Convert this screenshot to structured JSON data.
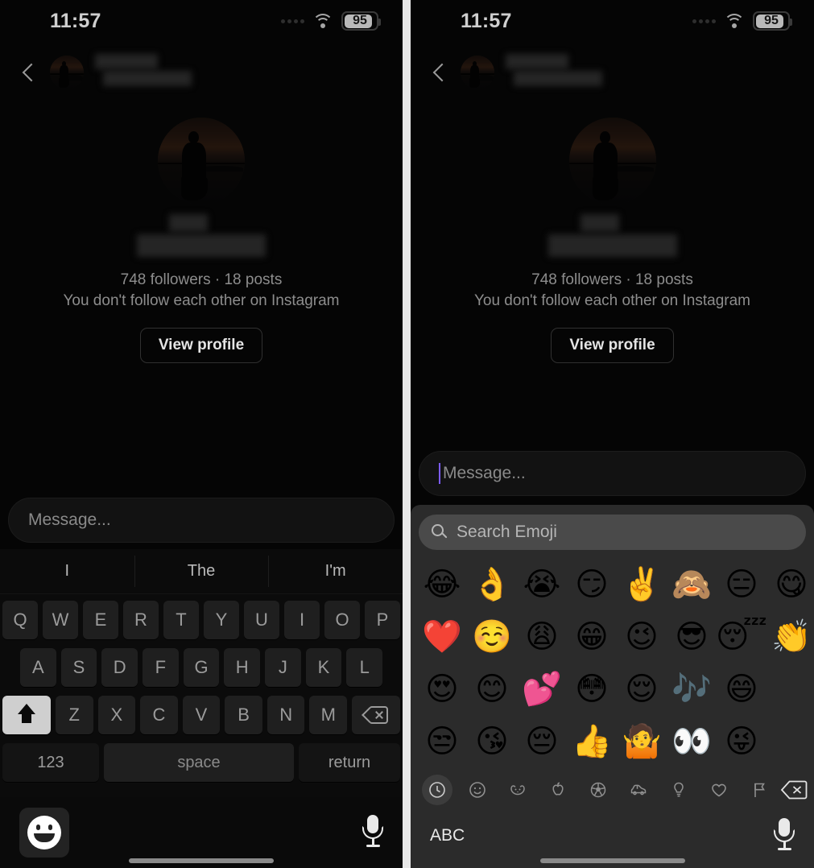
{
  "status": {
    "time": "11:57",
    "battery_percent": "95",
    "wifi_icon": "wifi-icon",
    "signal_icon": "cellular-dots-icon"
  },
  "header": {
    "back_icon": "back-chevron-icon",
    "avatar": "contact-avatar",
    "name_redacted": true
  },
  "profile": {
    "avatar": "profile-photo",
    "name_redacted": true,
    "stats": "748 followers · 18 posts",
    "followers": "748 followers",
    "posts": "18 posts",
    "relationship_note": "You don't follow each other on Instagram",
    "view_profile_label": "View profile"
  },
  "composer": {
    "placeholder": "Message...",
    "caret_color": "#7c5cff"
  },
  "keyboard": {
    "predictions": [
      "I",
      "The",
      "I'm"
    ],
    "row1": [
      "Q",
      "W",
      "E",
      "R",
      "T",
      "Y",
      "U",
      "I",
      "O",
      "P"
    ],
    "row2": [
      "A",
      "S",
      "D",
      "F",
      "G",
      "H",
      "J",
      "K",
      "L"
    ],
    "row3": [
      "Z",
      "X",
      "C",
      "V",
      "B",
      "N",
      "M"
    ],
    "shift_icon": "shift-arrow-icon",
    "backspace_icon": "backspace-icon",
    "numbers_label": "123",
    "space_label": "space",
    "return_label": "return"
  },
  "accessory": {
    "emoji_icon": "smiley-face-icon",
    "mic_icon": "microphone-icon"
  },
  "emoji_keyboard": {
    "search_placeholder": "Search Emoji",
    "search_icon": "search-icon",
    "rows": [
      [
        "😂",
        "👌",
        "😭",
        "😏",
        "✌️",
        "🙈",
        "😑",
        "😋"
      ],
      [
        "❤️",
        "☺️",
        "😩",
        "😁",
        "😉",
        "😎",
        "😴",
        "👏"
      ],
      [
        "😍",
        "😊",
        "💕",
        "😳",
        "😌",
        "🎶",
        "😄"
      ],
      [
        "😒",
        "😘",
        "😔",
        "👍",
        "🤷",
        "👀",
        "😜"
      ]
    ],
    "categories": [
      {
        "name": "recents-category",
        "icon": "clock-icon",
        "active": true
      },
      {
        "name": "smileys-category",
        "icon": "smiley-icon",
        "active": false
      },
      {
        "name": "animals-category",
        "icon": "animal-icon",
        "active": false
      },
      {
        "name": "food-category",
        "icon": "apple-icon",
        "active": false
      },
      {
        "name": "activity-category",
        "icon": "soccer-ball-icon",
        "active": false
      },
      {
        "name": "travel-category",
        "icon": "car-icon",
        "active": false
      },
      {
        "name": "objects-category",
        "icon": "lightbulb-icon",
        "active": false
      },
      {
        "name": "symbols-category",
        "icon": "heart-icon",
        "active": false
      },
      {
        "name": "flags-category",
        "icon": "flag-icon",
        "active": false
      }
    ],
    "delete_icon": "backspace-icon",
    "abc_label": "ABC",
    "mic_icon": "microphone-icon"
  }
}
